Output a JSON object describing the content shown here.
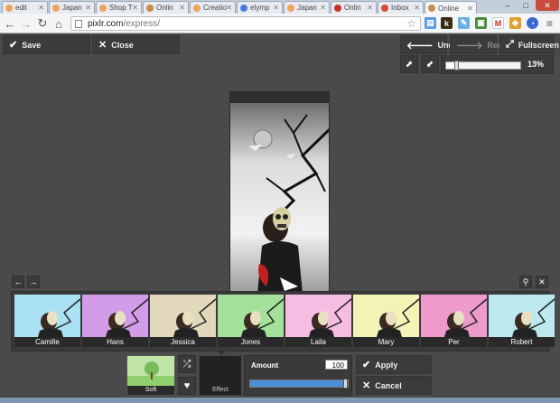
{
  "browser": {
    "tabs": [
      {
        "label": "edit",
        "fav": "#f0a35b"
      },
      {
        "label": "Japan",
        "fav": "#f0a35b"
      },
      {
        "label": "Shop T",
        "fav": "#f0a35b"
      },
      {
        "label": "Onlin",
        "fav": "#c98b50"
      },
      {
        "label": "Creatio",
        "fav": "#f0a35b"
      },
      {
        "label": "elymp",
        "fav": "#4a7bd6"
      },
      {
        "label": "Japan",
        "fav": "#f0a35b"
      },
      {
        "label": "Onlin",
        "fav": "#c5312a"
      },
      {
        "label": "Inbox",
        "fav": "#d64b3b"
      },
      {
        "label": "Online",
        "fav": "#c98b50"
      }
    ],
    "url_host": "pixlr.com",
    "url_path": "/express/",
    "back_icon": "back-arrow-icon",
    "forward_icon": "forward-arrow-icon",
    "reload_icon": "reload-icon",
    "home_icon": "home-icon"
  },
  "app": {
    "save_label": "Save",
    "close_label": "Close",
    "undo_label": "Undo",
    "redo_label": "Redo",
    "fullscreen_label": "Fullscreen",
    "zoom_value": "13%",
    "zoom_fraction": 0.13
  },
  "effects": {
    "items": [
      {
        "label": "Camille",
        "tint": "#8fd9ef"
      },
      {
        "label": "Hans",
        "tint": "#c47be0"
      },
      {
        "label": "Jessica",
        "tint": "#d9cba6"
      },
      {
        "label": "Jones",
        "tint": "#86d97a"
      },
      {
        "label": "Laila",
        "tint": "#f3a6d8"
      },
      {
        "label": "Mary",
        "tint": "#f1ef9e"
      },
      {
        "label": "Per",
        "tint": "#e879b8"
      },
      {
        "label": "Robert",
        "tint": "#a6e0ea"
      }
    ]
  },
  "bottom_panel": {
    "soft_label": "Soft",
    "effect_label": "Effect",
    "amount_label": "Amount",
    "amount_value": "100",
    "amount_fraction": 1.0,
    "apply_label": "Apply",
    "cancel_label": "Cancel"
  }
}
